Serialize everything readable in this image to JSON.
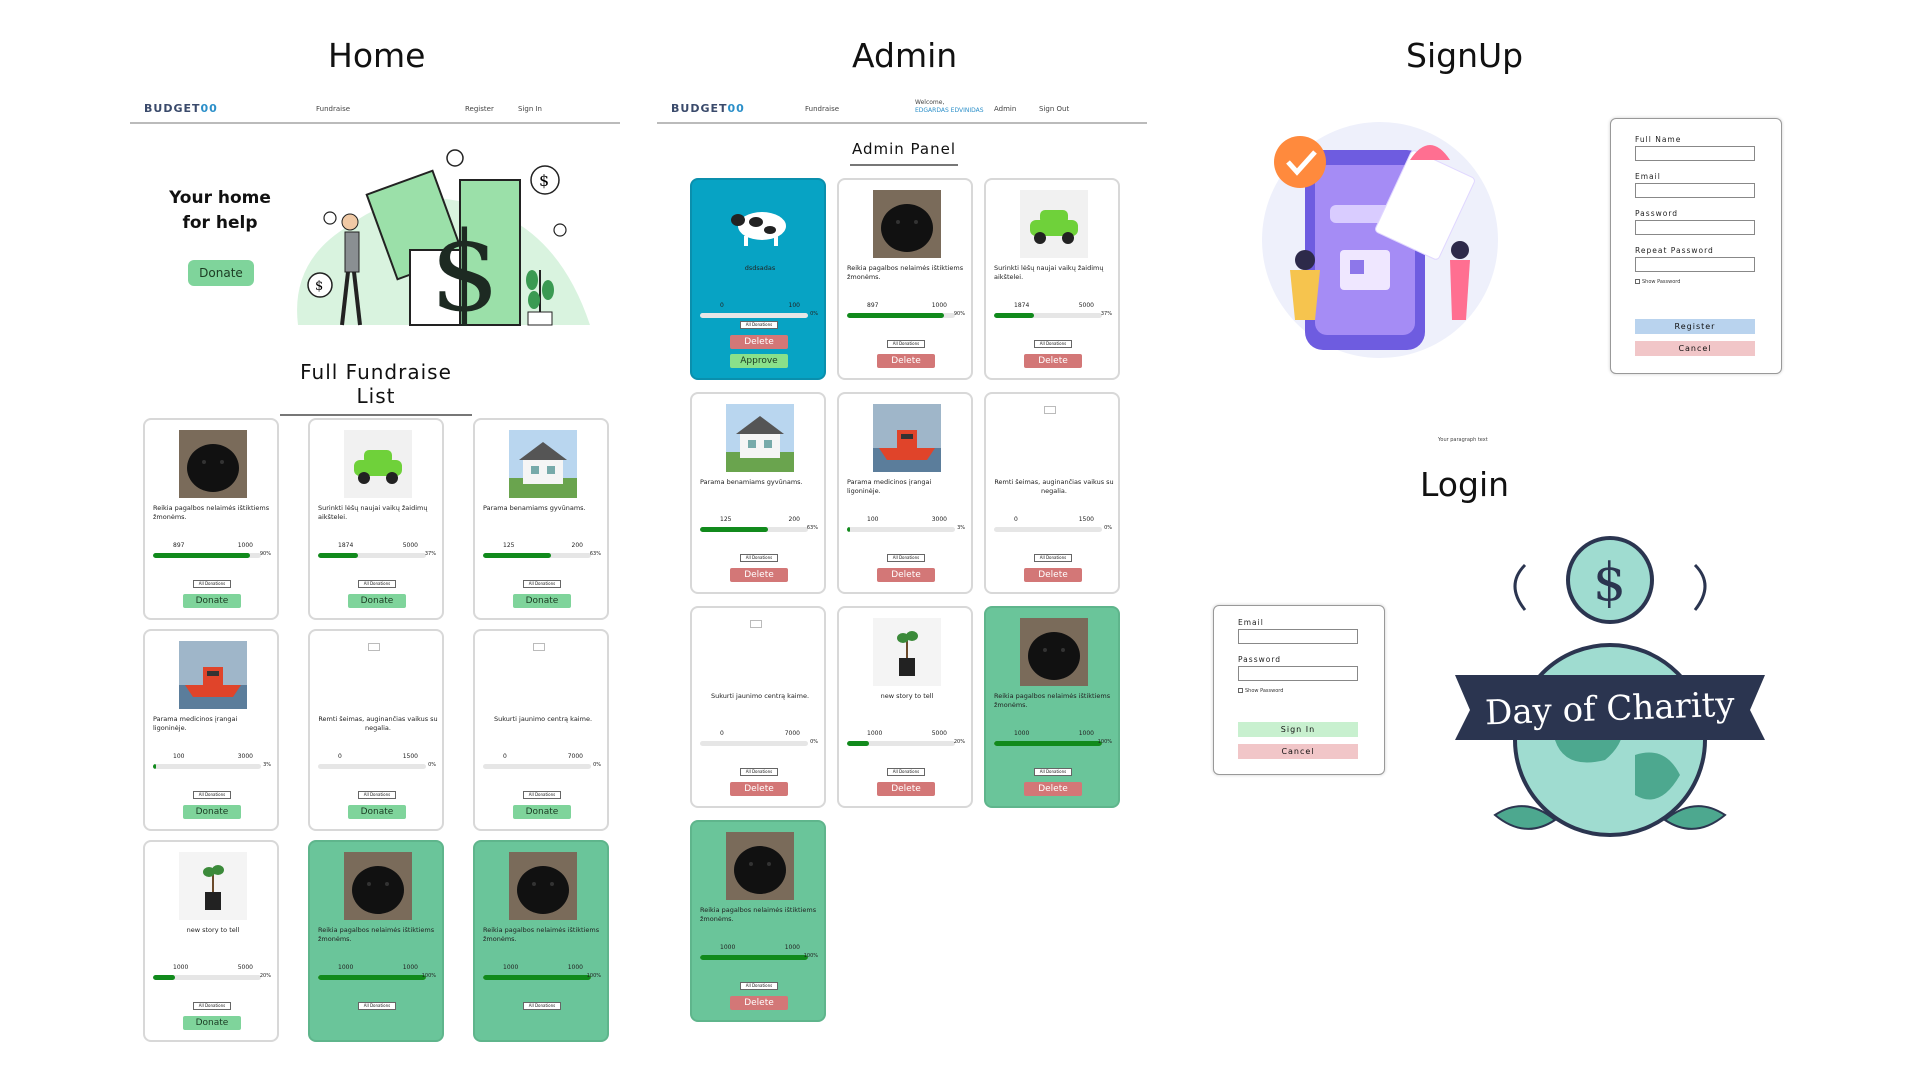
{
  "sections": {
    "home": "Home",
    "admin": "Admin",
    "signup": "SignUp",
    "login": "Login"
  },
  "home_nav": {
    "logo": "BUDGET",
    "logo_accent": "00",
    "fundraise": "Fundraise",
    "register": "Register",
    "sign_in": "Sign In"
  },
  "admin_nav": {
    "logo": "BUDGET",
    "logo_accent": "00",
    "fundraise": "Fundraise",
    "welcome": "Welcome,",
    "welcome_name": "EDGARDAS EDVINIDAS",
    "admin": "Admin",
    "sign_out": "Sign Out"
  },
  "hero": {
    "line1": "Your home",
    "line2": "for help",
    "donate": "Donate"
  },
  "list_title": "Full Fundraise List",
  "admin_panel_title": "Admin Panel",
  "labels": {
    "all_donations": "All Donations",
    "donate": "Donate",
    "delete": "Delete",
    "approve": "Approve"
  },
  "home_cards": [
    {
      "title": "Reikia pagalbos nelaimės ištiktiems žmonėms.",
      "raised": "897",
      "goal": "1000",
      "pct": "90%",
      "progress": 0.9,
      "state": "active",
      "img": "dog"
    },
    {
      "title": "Surinkti lėšų naujai vaikų žaidimų aikštelei.",
      "raised": "1874",
      "goal": "5000",
      "pct": "37%",
      "progress": 0.37,
      "state": "active",
      "img": "car"
    },
    {
      "title": "Parama benamiams gyvūnams.",
      "raised": "125",
      "goal": "200",
      "pct": "63%",
      "progress": 0.63,
      "state": "active",
      "img": "house"
    },
    {
      "title": "Parama medicinos įrangai ligoninėje.",
      "raised": "100",
      "goal": "3000",
      "pct": "3%",
      "progress": 0.03,
      "state": "active",
      "img": "boat"
    },
    {
      "title": "Remti šeimas, auginančias vaikus su negalia.",
      "raised": "0",
      "goal": "1500",
      "pct": "0%",
      "progress": 0,
      "state": "active",
      "img": "broken"
    },
    {
      "title": "Sukurti jaunimo centrą kaime.",
      "raised": "0",
      "goal": "7000",
      "pct": "0%",
      "progress": 0,
      "state": "active",
      "img": "broken"
    },
    {
      "title": "new story to tell",
      "raised": "1000",
      "goal": "5000",
      "pct": "20%",
      "progress": 0.2,
      "state": "active",
      "img": "plant"
    },
    {
      "title": "Reikia pagalbos nelaimės ištiktiems žmonėms.",
      "raised": "1000",
      "goal": "1000",
      "pct": "100%",
      "progress": 1,
      "state": "done",
      "img": "dog"
    },
    {
      "title": "Reikia pagalbos nelaimės ištiktiems žmonėms.",
      "raised": "1000",
      "goal": "1000",
      "pct": "100%",
      "progress": 1,
      "state": "done",
      "img": "dog"
    }
  ],
  "admin_cards": [
    {
      "title": "dsdsadas",
      "raised": "0",
      "goal": "100",
      "pct": "0%",
      "progress": 0,
      "state": "pending",
      "img": "cow"
    },
    {
      "title": "Reikia pagalbos nelaimės ištiktiems žmonėms.",
      "raised": "897",
      "goal": "1000",
      "pct": "90%",
      "progress": 0.9,
      "state": "active",
      "img": "dog"
    },
    {
      "title": "Surinkti lėšų naujai vaikų žaidimų aikštelei.",
      "raised": "1874",
      "goal": "5000",
      "pct": "37%",
      "progress": 0.37,
      "state": "active",
      "img": "car"
    },
    {
      "title": "Parama benamiams gyvūnams.",
      "raised": "125",
      "goal": "200",
      "pct": "63%",
      "progress": 0.63,
      "state": "active",
      "img": "house"
    },
    {
      "title": "Parama medicinos įrangai ligoninėje.",
      "raised": "100",
      "goal": "3000",
      "pct": "3%",
      "progress": 0.03,
      "state": "active",
      "img": "boat"
    },
    {
      "title": "Remti šeimas, auginančias vaikus su negalia.",
      "raised": "0",
      "goal": "1500",
      "pct": "0%",
      "progress": 0,
      "state": "active",
      "img": "broken"
    },
    {
      "title": "Sukurti jaunimo centrą kaime.",
      "raised": "0",
      "goal": "7000",
      "pct": "0%",
      "progress": 0,
      "state": "active",
      "img": "broken"
    },
    {
      "title": "new story to tell",
      "raised": "1000",
      "goal": "5000",
      "pct": "20%",
      "progress": 0.2,
      "state": "active",
      "img": "plant"
    },
    {
      "title": "Reikia pagalbos nelaimės ištiktiems žmonėms.",
      "raised": "1000",
      "goal": "1000",
      "pct": "100%",
      "progress": 1,
      "state": "done",
      "img": "dog"
    },
    {
      "title": "Reikia pagalbos nelaimės ištiktiems žmonėms.",
      "raised": "1000",
      "goal": "1000",
      "pct": "100%",
      "progress": 1,
      "state": "done",
      "img": "dog"
    }
  ],
  "signup_form": {
    "full_name": "Full Name",
    "email": "Email",
    "password": "Password",
    "repeat_password": "Repeat Password",
    "show_password": "Show Password",
    "register": "Register",
    "cancel": "Cancel"
  },
  "login_form": {
    "email": "Email",
    "password": "Password",
    "show_password": "Show Password",
    "sign_in": "Sign In",
    "cancel": "Cancel"
  },
  "paragraph_text": "Your paragraph text",
  "charity_banner": "Day of Charity",
  "colors": {
    "green_button": "#7fd49b",
    "delete_button": "#d37777",
    "completed_card": "#6ac59a",
    "pending_card": "#07a3c4",
    "progress_fill": "#118a1c",
    "register_button": "#b9d3ee",
    "cancel_button": "#f1c6c8",
    "sign_in_button": "#c8f0cf"
  }
}
